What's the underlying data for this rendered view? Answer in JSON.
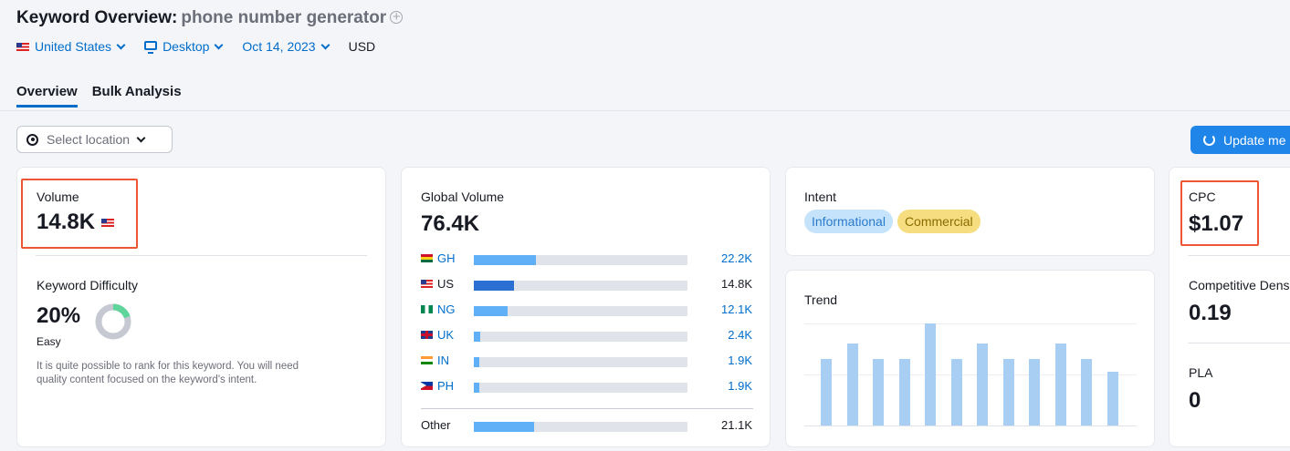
{
  "header": {
    "title_prefix": "Keyword Overview:",
    "keyword": "phone number generator",
    "plus": "+",
    "country": "United States",
    "device": "Desktop",
    "date": "Oct 14, 2023",
    "currency": "USD"
  },
  "tabs": [
    {
      "label": "Overview"
    },
    {
      "label": "Bulk Analysis"
    }
  ],
  "location": {
    "placeholder": "Select location"
  },
  "update_button": {
    "label": "Update me"
  },
  "volume": {
    "label": "Volume",
    "value": "14.8K"
  },
  "difficulty": {
    "label": "Keyword Difficulty",
    "value": "20%",
    "percent": 20,
    "level": "Easy",
    "description_line1": "It is quite possible to rank for this keyword. You will need",
    "description_line2": "quality content focused on the keyword's intent."
  },
  "global_volume": {
    "label": "Global Volume",
    "value": "76.4K",
    "rows": [
      {
        "code": "GH",
        "value": "22.2K",
        "share": 0.29
      },
      {
        "code": "US",
        "value": "14.8K",
        "share": 0.19
      },
      {
        "code": "NG",
        "value": "12.1K",
        "share": 0.16
      },
      {
        "code": "UK",
        "value": "2.4K",
        "share": 0.03
      },
      {
        "code": "IN",
        "value": "1.9K",
        "share": 0.025
      },
      {
        "code": "PH",
        "value": "1.9K",
        "share": 0.025
      }
    ],
    "other": {
      "label": "Other",
      "value": "21.1K",
      "share": 0.28
    }
  },
  "intent": {
    "label": "Intent",
    "tags": [
      "Informational",
      "Commercial"
    ]
  },
  "trend": {
    "label": "Trend",
    "values": [
      0.65,
      0.8,
      0.65,
      0.65,
      1.0,
      0.65,
      0.8,
      0.65,
      0.65,
      0.8,
      0.65,
      0.53
    ]
  },
  "cpc": {
    "label": "CPC",
    "value": "$1.07"
  },
  "competitive_density": {
    "label": "Competitive Density",
    "value": "0.19"
  },
  "pla": {
    "label": "PLA",
    "value": "0"
  },
  "colors": {
    "accent": "#006dca",
    "highlight": "#ee5532",
    "bar_light": "#5fb0f6",
    "bar_dark": "#2c6fd2",
    "trend_bar": "#a8cef3"
  }
}
